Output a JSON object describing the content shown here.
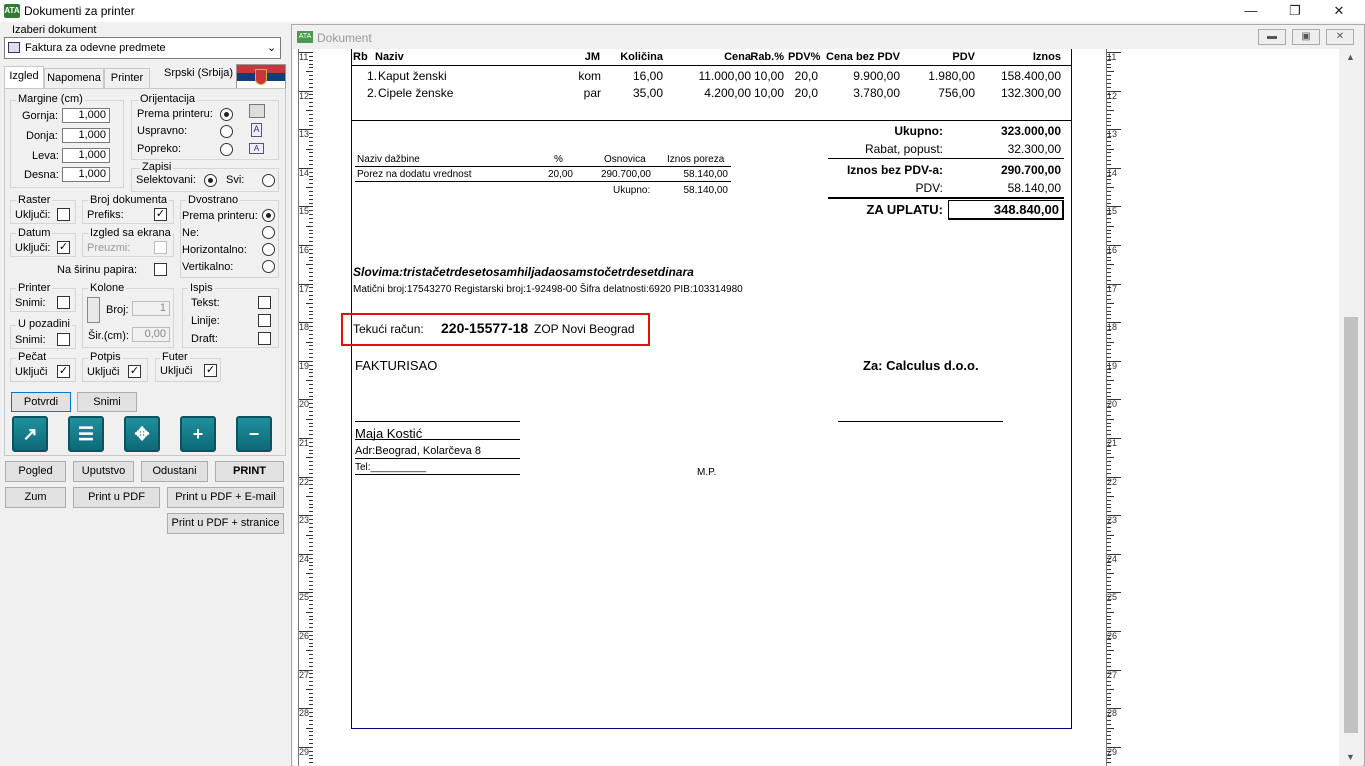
{
  "window": {
    "title": "Dokumenti za printer",
    "logo": "ATA"
  },
  "left": {
    "doc_select_label": "Izaberi dokument",
    "doc_select_value": "Faktura za odevne predmete",
    "tabs": [
      "Izgled",
      "Napomena",
      "Printer"
    ],
    "language": "Srpski (Srbija)",
    "margins": {
      "title": "Margine (cm)",
      "gornja_l": "Gornja:",
      "gornja_v": "1,000",
      "donja_l": "Donja:",
      "donja_v": "1,000",
      "leva_l": "Leva:",
      "leva_v": "1,000",
      "desna_l": "Desna:",
      "desna_v": "1,000"
    },
    "orient": {
      "title": "Orijentacija",
      "o1": "Prema printeru:",
      "o2": "Uspravno:",
      "o3": "Popreko:"
    },
    "zapisi": {
      "title": "Zapisi",
      "sel": "Selektovani:",
      "svi": "Svi:"
    },
    "raster": {
      "title": "Raster",
      "ukljuci": "Uključi:"
    },
    "broj": {
      "title": "Broj dokumenta",
      "prefiks": "Prefiks:"
    },
    "dvostrano": {
      "title": "Dvostrano",
      "d1": "Prema printeru:",
      "d2": "Ne:",
      "d3": "Horizontalno:",
      "d4": "Vertikalno:"
    },
    "datum": {
      "title": "Datum",
      "ukljuci": "Uključi:"
    },
    "izgled": {
      "title": "Izgled sa ekrana",
      "preuzmi": "Preuzmi:"
    },
    "sirina": "Na širinu papira:",
    "printer": {
      "title": "Printer",
      "snimi": "Snimi:"
    },
    "kolone": {
      "title": "Kolone",
      "broj": "Broj:",
      "broj_v": "1",
      "sir": "Šir.(cm):",
      "sir_v": "0,00"
    },
    "ispis": {
      "title": "Ispis",
      "tekst": "Tekst:",
      "linije": "Linije:",
      "draft": "Draft:"
    },
    "pozadini": {
      "title": "U pozadini",
      "snimi": "Snimi:"
    },
    "pecat": {
      "title": "Pečat",
      "ukljuci": "Uključi"
    },
    "potpis": {
      "title": "Potpis",
      "ukljuci": "Uključi"
    },
    "futer": {
      "title": "Futer",
      "ukljuci": "Uključi"
    },
    "potvrdi": "Potvrdi",
    "snimi": "Snimi",
    "icons": [
      "text-export-icon",
      "document-icon",
      "move-icon",
      "zoom-in-icon",
      "zoom-out-icon"
    ],
    "buttons": {
      "pogled": "Pogled",
      "uputstvo": "Uputstvo",
      "odustani": "Odustani",
      "print": "PRINT",
      "zum": "Zum",
      "pdf": "Print u PDF",
      "pdf_email": "Print u PDF  + E-mail",
      "pdf_stranice": "Print u PDF  + stranice"
    }
  },
  "docwin": {
    "title": "Dokument"
  },
  "ruler": [
    "11",
    "12",
    "13",
    "14",
    "15",
    "16",
    "17",
    "18",
    "19",
    "20",
    "21",
    "22",
    "23",
    "24",
    "25",
    "26",
    "27",
    "28",
    "29"
  ],
  "invoice": {
    "headers": [
      "Rb",
      "Naziv",
      "JM",
      "Količina",
      "Cena",
      "Rab.%",
      "PDV%",
      "Cena bez PDV",
      "PDV",
      "Iznos"
    ],
    "rows": [
      [
        "1.",
        "Kaput ženski",
        "kom",
        "16,00",
        "11.000,00",
        "10,00",
        "20,0",
        "9.900,00",
        "1.980,00",
        "158.400,00"
      ],
      [
        "2.",
        "Cipele ženske",
        "par",
        "35,00",
        "4.200,00",
        "10,00",
        "20,0",
        "3.780,00",
        "756,00",
        "132.300,00"
      ]
    ],
    "tax": {
      "headers": [
        "Naziv dažbine",
        "%",
        "Osnovica",
        "Iznos poreza"
      ],
      "row": [
        "Porez na dodatu vrednost",
        "20,00",
        "290.700,00",
        "58.140,00"
      ],
      "ukupno_l": "Ukupno:",
      "ukupno_v": "58.140,00"
    },
    "totals": {
      "ukupno_l": "Ukupno:",
      "ukupno_v": "323.000,00",
      "rabat_l": "Rabat, popust:",
      "rabat_v": "32.300,00",
      "bezpdv_l": "Iznos bez PDV-a:",
      "bezpdv_v": "290.700,00",
      "pdv_l": "PDV:",
      "pdv_v": "58.140,00",
      "uplata_l": "ZA UPLATU:",
      "uplata_v": "348.840,00"
    },
    "slovima": "Slovima:tristačetrdesetosamhiljadaosamstočetrdesetdinara",
    "maticni": "Matični broj:17543270 Registarski broj:1-92498-00 Šifra delatnosti:6920 PIB:103314980",
    "racun_l": "Tekući račun:",
    "racun_v": "220-15577-18",
    "banka": "ZOP Novi Beograd",
    "fakturisao": "FAKTURISAO",
    "za": "Za: Calculus d.o.o.",
    "ime": "Maja Kostić",
    "adr": "Adr:Beograd, Kolarčeva 8",
    "tel": "Tel:__________",
    "mp": "M.P."
  },
  "colors": {
    "highlight": "#e01010",
    "border": "#00007f",
    "teal": "#0e6a78"
  }
}
